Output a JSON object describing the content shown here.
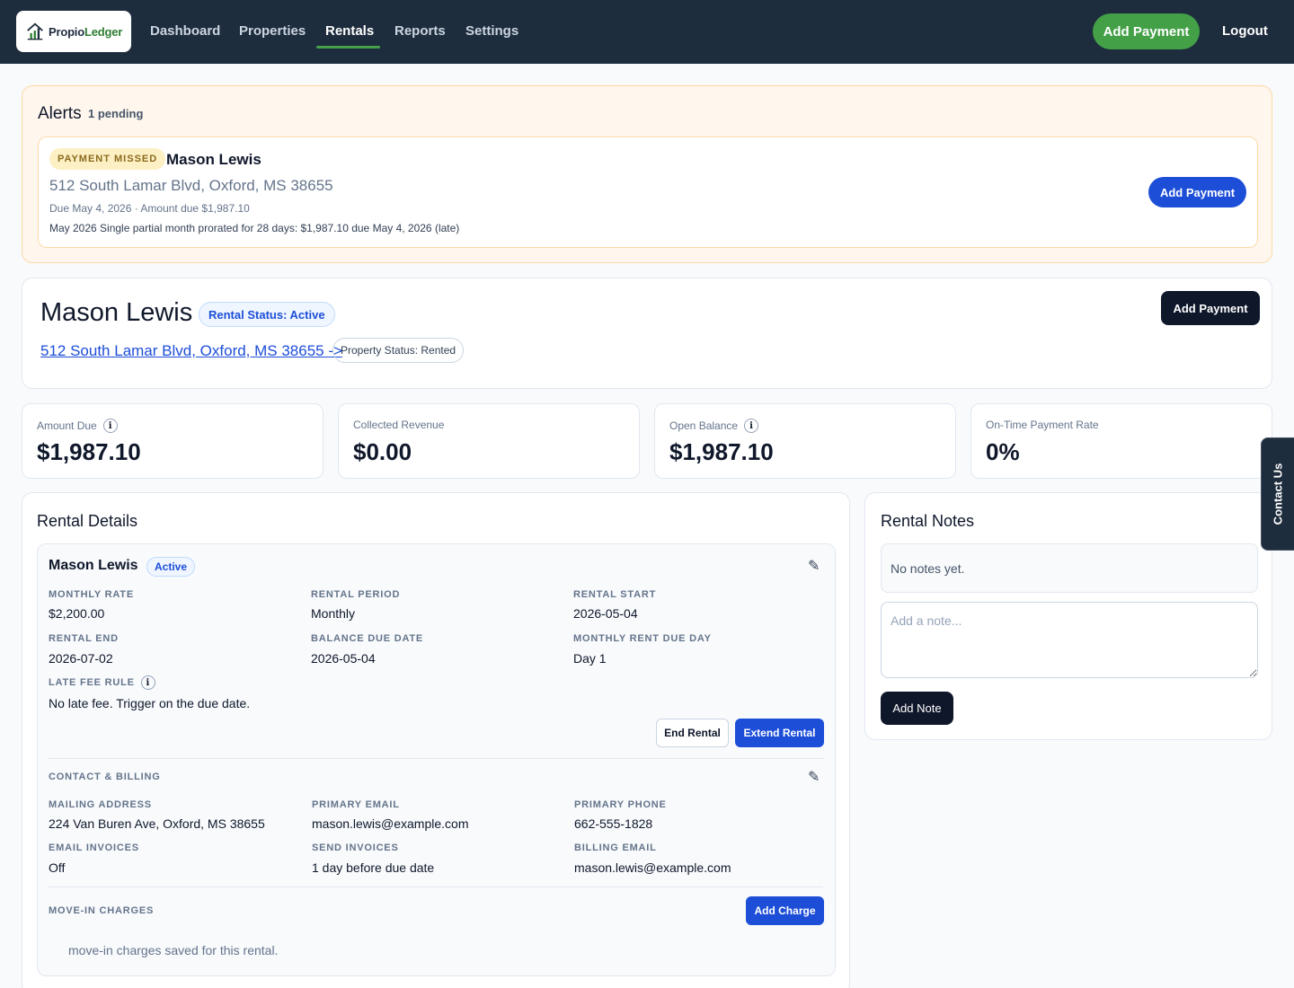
{
  "app": {
    "logo_part1": "Propio",
    "logo_part2": "Ledger",
    "accent_color": "#43a047",
    "nav_bg": "#1e2d3d",
    "primary_blue": "#1d4ed8"
  },
  "nav": {
    "items": [
      "Dashboard",
      "Properties",
      "Rentals",
      "Reports",
      "Settings"
    ],
    "active": "Rentals",
    "add_payment": "Add Payment",
    "logout": "Logout"
  },
  "alerts": {
    "title": "Alerts",
    "count": "1 pending",
    "item": {
      "badge": "PAYMENT MISSED",
      "name": "Mason Lewis",
      "address": "512 South Lamar Blvd, Oxford, MS 38655",
      "due_line": "Due May 4, 2026 · Amount due $1,987.10",
      "description": "May 2026 Single partial month prorated for 28 days: $1,987.10 due May 4, 2026 (late)",
      "button": "Add Payment"
    }
  },
  "header": {
    "tenant_name": "Mason Lewis",
    "rental_status": "Rental Status: Active",
    "property_link": "512 South Lamar Blvd, Oxford, MS 38655 ->",
    "property_status": "Property Status: Rented",
    "add_payment": "Add Payment"
  },
  "stats": [
    {
      "label": "Amount Due",
      "value": "$1,987.10",
      "info_icon": true
    },
    {
      "label": "Collected Revenue",
      "value": "$0.00",
      "info_icon": false
    },
    {
      "label": "Open Balance",
      "value": "$1,987.10",
      "info_icon": true
    },
    {
      "label": "On-Time Payment Rate",
      "value": "0%",
      "info_icon": false
    }
  ],
  "info_glyph": "i",
  "details": {
    "title": "Rental Details",
    "tenant": "Mason Lewis",
    "status": "Active",
    "edit_icon": "pencil-icon",
    "fields": [
      {
        "label": "MONTHLY RATE",
        "value": "$2,200.00"
      },
      {
        "label": "RENTAL PERIOD",
        "value": "Monthly"
      },
      {
        "label": "RENTAL START",
        "value": "2026-05-04"
      },
      {
        "label": "RENTAL END",
        "value": "2026-07-02"
      },
      {
        "label": "BALANCE DUE DATE",
        "value": "2026-05-04"
      },
      {
        "label": "MONTHLY RENT DUE DAY",
        "value": "Day 1"
      }
    ],
    "late_fee": {
      "label": "LATE FEE RULE",
      "value": "No late fee. Trigger on the due date."
    },
    "end_rental": "End Rental",
    "extend_rental": "Extend Rental",
    "contact_section": {
      "title": "CONTACT & BILLING",
      "fields": [
        {
          "label": "MAILING ADDRESS",
          "value": "224 Van Buren Ave, Oxford, MS 38655"
        },
        {
          "label": "PRIMARY EMAIL",
          "value": "mason.lewis@example.com"
        },
        {
          "label": "PRIMARY PHONE",
          "value": "662-555-1828"
        },
        {
          "label": "EMAIL INVOICES",
          "value": "Off"
        },
        {
          "label": "SEND INVOICES",
          "value": "1 day before due date"
        },
        {
          "label": "BILLING EMAIL",
          "value": "mason.lewis@example.com"
        }
      ]
    },
    "move_in": {
      "title": "MOVE-IN CHARGES",
      "button": "Add Charge",
      "empty": "move-in charges saved for this rental."
    }
  },
  "notes": {
    "title": "Rental Notes",
    "empty": "No notes yet.",
    "placeholder": "Add a note...",
    "button": "Add Note"
  },
  "contact_tab": "Contact Us"
}
